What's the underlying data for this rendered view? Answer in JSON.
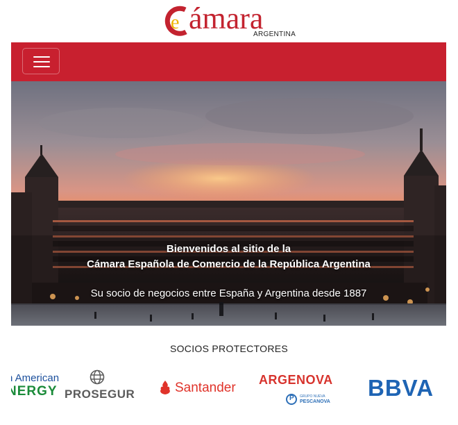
{
  "header": {
    "logo_text": "ámara",
    "logo_subtitle": "ARGENTINA",
    "brand_color": "#c3232f"
  },
  "navbar": {
    "background": "#c8202f",
    "toggler_icon": "hamburger-menu-icon"
  },
  "hero": {
    "line1": "Bienvenidos al sitio de la",
    "line2": "Cámara Española de Comercio de la República Argentina",
    "line3": "Su socio de negocios entre España y Argentina desde 1887"
  },
  "sponsors": {
    "title": "SOCIOS PROTECTORES",
    "items": [
      {
        "name": "Pan American Energy",
        "text_top": "n American",
        "text_bottom": "NERGY"
      },
      {
        "name": "Prosegur",
        "text": "PROSEGUR"
      },
      {
        "name": "Santander",
        "text": "Santander"
      },
      {
        "name": "Argenova",
        "text": "ARGENOVA",
        "sub_top": "GRUPO NUEVA",
        "sub_bottom": "PESCANOVA"
      },
      {
        "name": "BBVA",
        "text": "BBVA"
      }
    ]
  }
}
